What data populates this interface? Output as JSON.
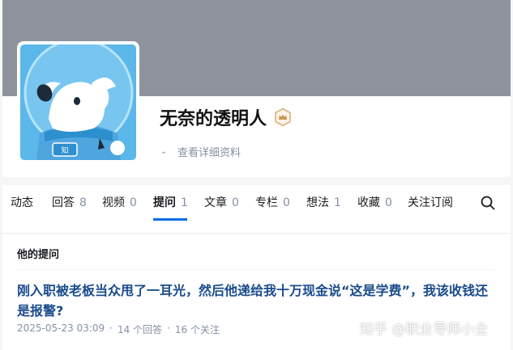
{
  "profile": {
    "name": "无奈的透明人",
    "badge_icon": "crown-badge-icon",
    "detail_link": "查看详细资料",
    "cover_color": "#8f939e",
    "avatar_bg": "#5cb7ea"
  },
  "tabs": [
    {
      "label": "动态",
      "count": ""
    },
    {
      "label": "回答",
      "count": "8"
    },
    {
      "label": "视频",
      "count": "0"
    },
    {
      "label": "提问",
      "count": "1",
      "active": true
    },
    {
      "label": "文章",
      "count": "0"
    },
    {
      "label": "专栏",
      "count": "0"
    },
    {
      "label": "想法",
      "count": "1"
    },
    {
      "label": "收藏",
      "count": "0"
    },
    {
      "label": "关注订阅",
      "count": ""
    }
  ],
  "search_icon": "search-icon",
  "section": {
    "title": "他的提问"
  },
  "question": {
    "title": "刚入职被老板当众甩了一耳光，然后他递给我十万现金说“这是学费”，我该收钱还是报警?",
    "date": "2025-05-23 03:09",
    "answers": "14 个回答",
    "followers": "16 个关注",
    "separator": "·"
  },
  "watermark": "知乎 @职业导师小全",
  "colors": {
    "accent": "#056de8",
    "link": "#1a4b8c",
    "muted": "#8590a6"
  }
}
